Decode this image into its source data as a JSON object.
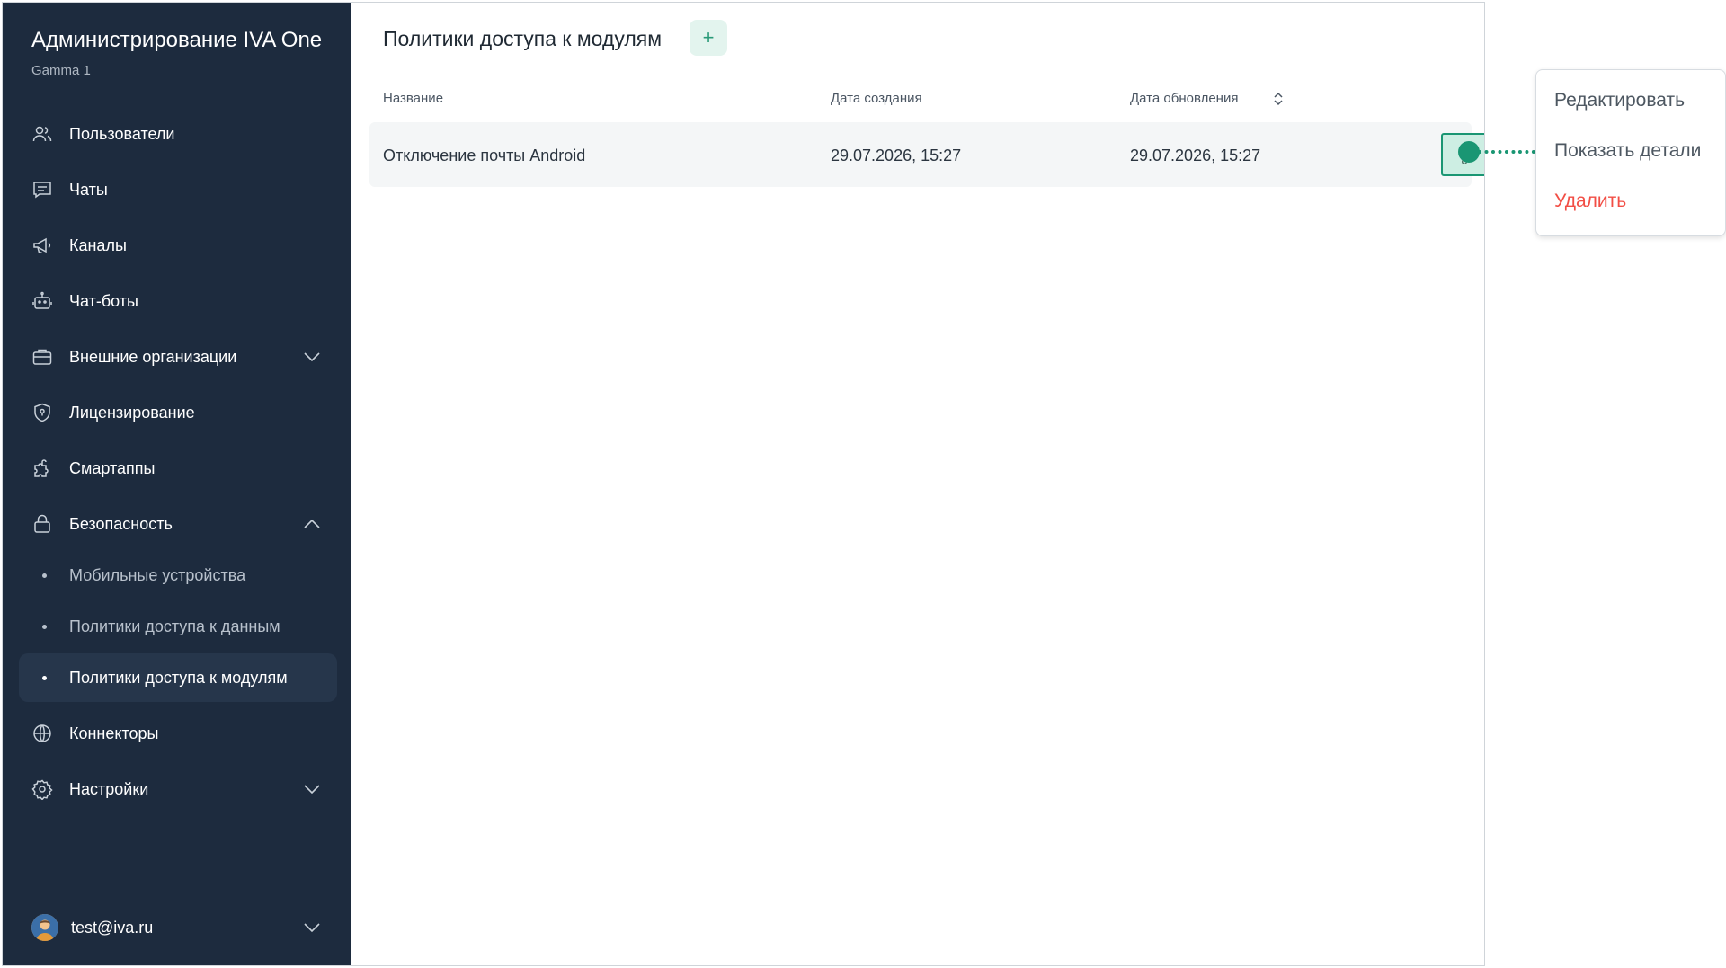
{
  "sidebar": {
    "title": "Администрирование IVA One",
    "subtitle": "Gamma 1",
    "items": [
      {
        "label": "Пользователи",
        "icon": "users-icon"
      },
      {
        "label": "Чаты",
        "icon": "chat-icon"
      },
      {
        "label": "Каналы",
        "icon": "megaphone-icon"
      },
      {
        "label": "Чат-боты",
        "icon": "robot-icon"
      },
      {
        "label": "Внешние организации",
        "icon": "briefcase-icon"
      },
      {
        "label": "Лицензирование",
        "icon": "shield-icon"
      },
      {
        "label": "Смартаппы",
        "icon": "puzzle-icon"
      },
      {
        "label": "Безопасность",
        "icon": "lock-icon"
      },
      {
        "label": "Коннекторы",
        "icon": "globe-icon"
      },
      {
        "label": "Настройки",
        "icon": "gear-icon"
      }
    ],
    "security_sub": [
      {
        "label": "Мобильные устройства"
      },
      {
        "label": "Политики доступа к данным"
      },
      {
        "label": "Политики доступа к модулям",
        "active": true
      }
    ],
    "user": "test@iva.ru"
  },
  "main": {
    "title": "Политики доступа к модулям",
    "add_label": "+",
    "columns": [
      "Название",
      "Дата создания",
      "Дата обновления"
    ],
    "rows": [
      {
        "name": "Отключение почты Android",
        "created": "29.07.2026, 15:27",
        "updated": "29.07.2026, 15:27"
      }
    ]
  },
  "context_menu": {
    "items": [
      "Редактировать",
      "Показать детали",
      "Удалить"
    ]
  },
  "colors": {
    "sidebar_bg": "#1d2b3e",
    "accent": "#1a9673",
    "danger": "#f24e45"
  }
}
